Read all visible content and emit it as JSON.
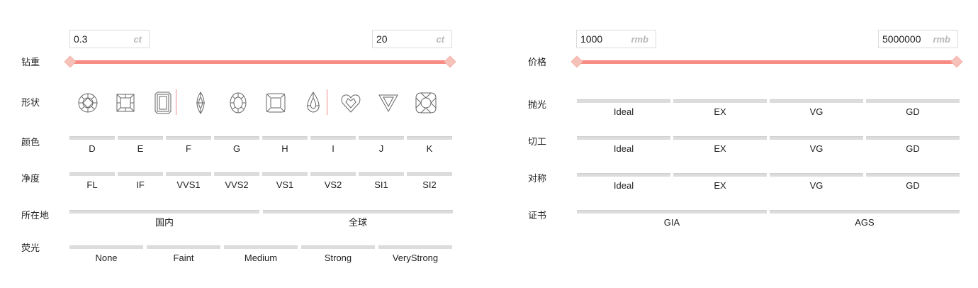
{
  "weight": {
    "label": "钻重",
    "min": "0.3",
    "max": "20",
    "unit": "ct"
  },
  "price": {
    "label": "价格",
    "min": "1000",
    "max": "5000000",
    "unit": "rmb"
  },
  "shape": {
    "label": "形状",
    "icons": [
      "round-icon",
      "princess-icon",
      "emerald-icon",
      "marquise-icon",
      "oval-icon",
      "cushion-square-icon",
      "pear-icon",
      "heart-icon",
      "trillion-icon",
      "cushion-icon"
    ]
  },
  "color": {
    "label": "颜色",
    "options": [
      "D",
      "E",
      "F",
      "G",
      "H",
      "I",
      "J",
      "K"
    ]
  },
  "clarity": {
    "label": "净度",
    "options": [
      "FL",
      "IF",
      "VVS1",
      "VVS2",
      "VS1",
      "VS2",
      "SI1",
      "SI2"
    ]
  },
  "location": {
    "label": "所在地",
    "options": [
      "国内",
      "全球"
    ]
  },
  "fluorescence": {
    "label": "荧光",
    "options": [
      "None",
      "Faint",
      "Medium",
      "Strong",
      "VeryStrong"
    ]
  },
  "polish": {
    "label": "抛光",
    "options": [
      "Ideal",
      "EX",
      "VG",
      "GD"
    ]
  },
  "cut": {
    "label": "切工",
    "options": [
      "Ideal",
      "EX",
      "VG",
      "GD"
    ]
  },
  "symmetry": {
    "label": "对称",
    "options": [
      "Ideal",
      "EX",
      "VG",
      "GD"
    ]
  },
  "certificate": {
    "label": "证书",
    "options": [
      "GIA",
      "AGS"
    ]
  },
  "colors": {
    "track": "#f88b84",
    "handle": "#f6c1b8",
    "option_bar": "#dcdcdc",
    "separator": "#f08a8a"
  }
}
